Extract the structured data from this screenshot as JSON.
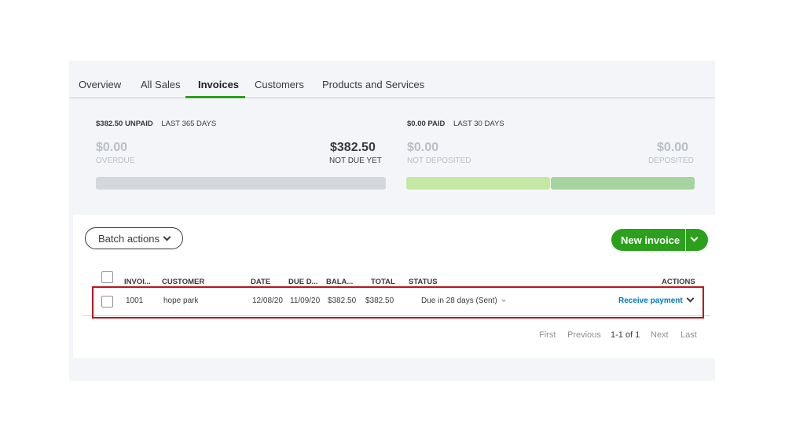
{
  "tabs": [
    {
      "label": "Overview"
    },
    {
      "label": "All Sales"
    },
    {
      "label": "Invoices",
      "active": true
    },
    {
      "label": "Customers"
    },
    {
      "label": "Products and Services"
    }
  ],
  "unpaid": {
    "amount_label": "$382.50 UNPAID",
    "period": "LAST 365 DAYS",
    "overdue_amount": "$0.00",
    "overdue_label": "OVERDUE",
    "not_due_amount": "$382.50",
    "not_due_label": "NOT DUE YET",
    "overdue_fraction": 0.0
  },
  "paid": {
    "amount_label": "$0.00 PAID",
    "period": "LAST 30 DAYS",
    "not_deposited_amount": "$0.00",
    "not_deposited_label": "NOT DEPOSITED",
    "deposited_amount": "$0.00",
    "deposited_label": "DEPOSITED"
  },
  "colors": {
    "brand_green": "#2ca01c",
    "link_blue": "#0077c5",
    "bar_gray": "#d4d7dc",
    "bar_light_green": "#c4e8a3",
    "bar_green": "#a6d4a0",
    "highlight_red": "#c1121f"
  },
  "toolbar": {
    "batch_actions": "Batch actions",
    "new_invoice": "New invoice"
  },
  "table": {
    "headers": {
      "invoice": "INVOI...",
      "customer": "CUSTOMER",
      "date": "DATE",
      "due_date": "DUE D...",
      "balance": "BALA...",
      "total": "TOTAL",
      "status": "STATUS",
      "actions": "ACTIONS"
    },
    "rows": [
      {
        "invoice": "1001",
        "customer": "hope park",
        "date": "12/08/20",
        "due_date": "11/09/20",
        "balance": "$382.50",
        "total": "$382.50",
        "status": "Due in 28 days (Sent)",
        "action": "Receive payment"
      }
    ]
  },
  "pagination": {
    "first": "First",
    "previous": "Previous",
    "range": "1-1 of 1",
    "next": "Next",
    "last": "Last"
  }
}
